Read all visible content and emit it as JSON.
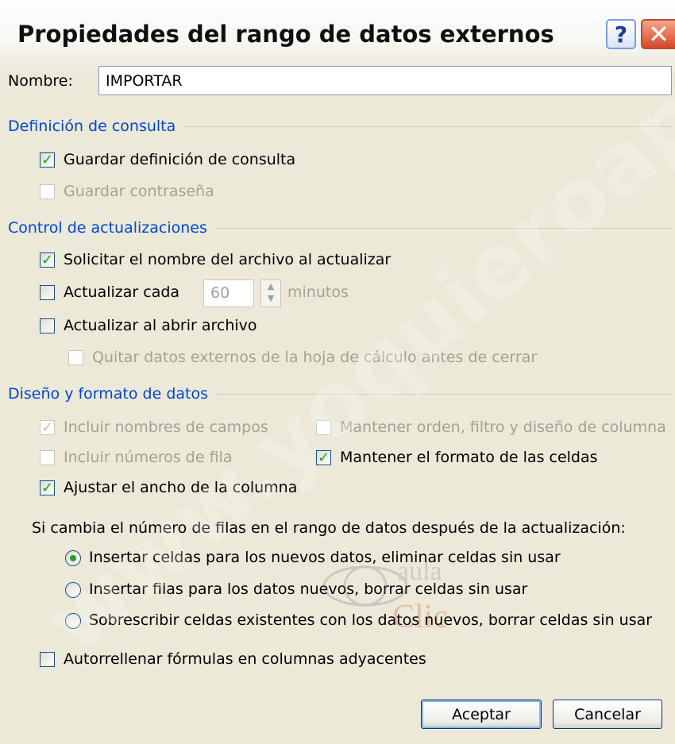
{
  "dialog": {
    "title": "Propiedades del rango de datos externos",
    "help_glyph": "?",
    "close_glyph": "✕"
  },
  "name": {
    "label": "Nombre:",
    "value": "IMPORTAR"
  },
  "query_definition": {
    "header": "Definición de consulta",
    "save_query": {
      "label": "Guardar definición de consulta",
      "checked": true
    },
    "save_password": {
      "label": "Guardar contraseña",
      "checked": false,
      "disabled": true
    }
  },
  "refresh_control": {
    "header": "Control de actualizaciones",
    "prompt_filename": {
      "label": "Solicitar el nombre del archivo al actualizar",
      "checked": true
    },
    "refresh_every": {
      "label": "Actualizar cada",
      "checked": false,
      "minutes_value": "60",
      "minutes_unit": "minutos"
    },
    "refresh_on_open": {
      "label": "Actualizar al abrir archivo",
      "checked": false
    },
    "remove_external": {
      "label": "Quitar datos externos de la hoja de cálculo antes de cerrar",
      "checked": false,
      "disabled": true
    }
  },
  "layout": {
    "header": "Diseño y formato de datos",
    "include_field_names": {
      "label": "Incluir nombres de campos",
      "checked": true,
      "disabled": true
    },
    "keep_sort_filter": {
      "label": "Mantener orden, filtro y diseño de columna",
      "checked": false,
      "disabled": true
    },
    "include_row_numbers": {
      "label": "Incluir números de fila",
      "checked": false,
      "disabled": true
    },
    "keep_cell_format": {
      "label": "Mantener el formato de las celdas",
      "checked": true
    },
    "adjust_column_width": {
      "label": "Ajustar el ancho de la columna",
      "checked": true
    },
    "rows_change_text": "Si cambia el número de filas en el rango de datos después de la actualización:",
    "radio_options": [
      {
        "label": "Insertar celdas para los nuevos datos, eliminar celdas sin usar",
        "selected": true
      },
      {
        "label": "Insertar filas para los datos nuevos, borrar celdas sin usar",
        "selected": false
      },
      {
        "label": "Sobrescribir celdas existentes con los datos nuevos, borrar celdas sin usar",
        "selected": false
      }
    ],
    "autofill_formulas": {
      "label": "Autorrellenar fórmulas en columnas adyacentes",
      "checked": false
    }
  },
  "buttons": {
    "ok": "Aceptar",
    "cancel": "Cancelar"
  },
  "watermark": {
    "diagonal": "www.yoquieroaprobar.es",
    "logo": [
      "aula",
      "Clic"
    ]
  },
  "colors": {
    "group_header": "#0046d5",
    "check_mark": "#21a121",
    "disabled_text": "#a5a295",
    "dialog_bg": "#ece9d8"
  },
  "icons": {
    "check": "check-icon",
    "help": "help-icon",
    "close": "close-icon",
    "spin": "spin-arrows-icon",
    "radio": "radio-dot-icon"
  }
}
